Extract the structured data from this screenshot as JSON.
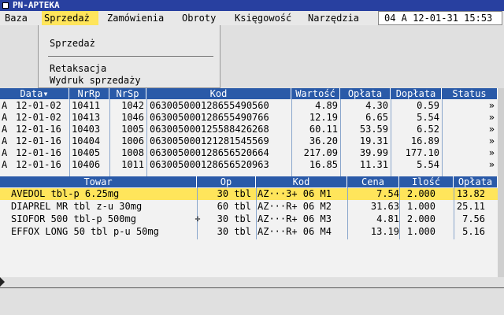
{
  "window": {
    "title": "PN-APTEKA"
  },
  "menu": {
    "items": [
      "Baza",
      "Sprzedaż",
      "Zamówienia",
      "Obroty",
      "Księgowość",
      "Narzędzia"
    ],
    "active": "Sprzedaż"
  },
  "clock": "04 A 12-01-31 15:53",
  "dropdown": {
    "items": [
      "Sprzedaż",
      "Retaksacja",
      "Wydruk sprzedaży"
    ]
  },
  "sales": {
    "columns": [
      "Data▾",
      "NrRp",
      "NrSp",
      "Kod",
      "Wartość",
      "Opłata",
      "Dopłata",
      "Status"
    ],
    "rows": [
      [
        "A",
        "12-01-02",
        "10411",
        "1042",
        "063005000128655490560",
        "4.89",
        "4.30",
        "0.59",
        "»"
      ],
      [
        "A",
        "12-01-02",
        "10413",
        "1046",
        "063005000128655490766",
        "12.19",
        "6.65",
        "5.54",
        "»"
      ],
      [
        "A",
        "12-01-16",
        "10403",
        "1005",
        "063005000125588426268",
        "60.11",
        "53.59",
        "6.52",
        "»"
      ],
      [
        "A",
        "12-01-16",
        "10404",
        "1006",
        "063005000121281545569",
        "36.20",
        "19.31",
        "16.89",
        "»"
      ],
      [
        "A",
        "12-01-16",
        "10405",
        "1008",
        "063005000128656520664",
        "217.09",
        "39.99",
        "177.10",
        "»"
      ],
      [
        "A",
        "12-01-16",
        "10406",
        "1011",
        "063005000128656520963",
        "16.85",
        "11.31",
        "5.54",
        "»"
      ]
    ]
  },
  "goods": {
    "columns": [
      "Towar",
      "Op",
      "Kod",
      "Cena",
      "Ilość",
      "Opłata"
    ],
    "rows": [
      [
        "AVEDOL tbl-p 6.25mg",
        "",
        "30 tbl",
        "AZ···3+ 06 M1",
        "7.54",
        "2.000",
        "13.82"
      ],
      [
        "DIAPREL MR tbl z-u 30mg",
        "",
        "60 tbl",
        "AZ···R+ 06 M2",
        "31.63",
        "1.000",
        "25.11"
      ],
      [
        "SIOFOR 500 tbl-p 500mg",
        "÷",
        "30 tbl",
        "AZ···R+ 06 M3",
        "4.81",
        "2.000",
        "7.56"
      ],
      [
        "EFFOX LONG 50 tbl p-u 50mg",
        "",
        "30 tbl",
        "AZ···R+ 06 M4",
        "13.19",
        "1.000",
        "5.16"
      ]
    ]
  },
  "colors": {
    "titlebar": "#2840a0",
    "header": "#2a5aa8",
    "highlight": "#ffe55b"
  }
}
